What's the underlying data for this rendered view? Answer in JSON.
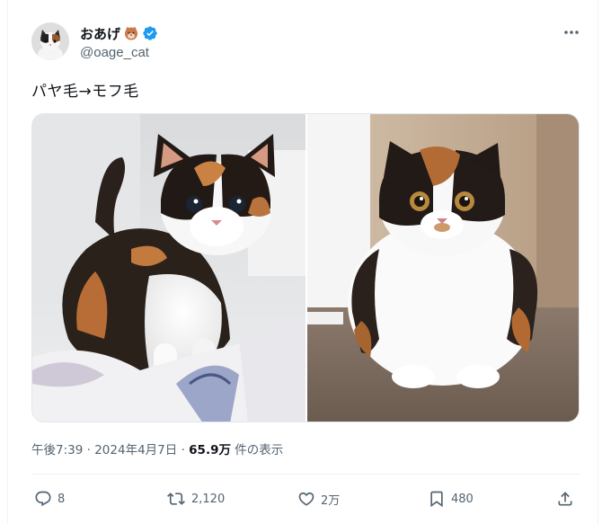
{
  "author": {
    "display_name": "おあげ",
    "handle": "@oage_cat",
    "verified": true,
    "name_emoji": "kitsune-face-emoji",
    "avatar_icon": "calico-cat-avatar"
  },
  "tweet": {
    "text": "パヤ毛→モフ毛",
    "media": [
      {
        "alt": "calico-kitten-photo"
      },
      {
        "alt": "fluffy-calico-cat-photo"
      }
    ]
  },
  "meta": {
    "time": "午後7:39",
    "separator": "·",
    "date": "2024年4月7日",
    "views": "65.9万",
    "views_suffix": "件の表示"
  },
  "actions": {
    "reply_count": "8",
    "retweet_count": "2,120",
    "like_count": "2万",
    "bookmark_count": "480"
  },
  "colors": {
    "text_primary": "#0f1419",
    "text_secondary": "#536471",
    "verified_blue": "#1d9bf0",
    "border": "#eff3f4"
  }
}
